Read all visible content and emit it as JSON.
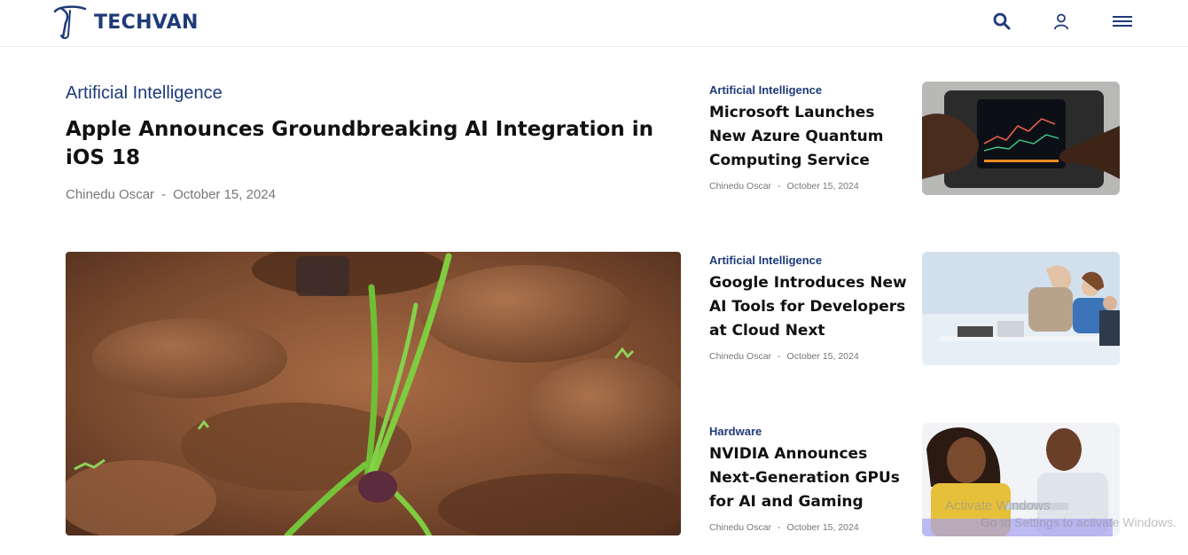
{
  "header": {
    "brand": "TECHVAN",
    "icons": [
      "search-icon",
      "user-icon",
      "menu-icon"
    ],
    "brand_color": "#1e3a78"
  },
  "featured": {
    "category": "Artificial Intelligence",
    "title": "Apple Announces Groundbreaking AI Integration in iOS 18",
    "author": "Chinedu Oscar",
    "separator": "-",
    "date": "October 15, 2024"
  },
  "side_articles": [
    {
      "category": "Artificial Intelligence",
      "title": "Microsoft Launches New Azure Quantum Computing Service",
      "author": "Chinedu Oscar",
      "separator": "-",
      "date": "October 15, 2024"
    },
    {
      "category": "Artificial Intelligence",
      "title": "Google Introduces New AI Tools for Developers at Cloud Next",
      "author": "Chinedu Oscar",
      "separator": "-",
      "date": "October 15, 2024"
    },
    {
      "category": "Hardware",
      "title": "NVIDIA Announces Next-Generation GPUs for AI and Gaming",
      "author": "Chinedu Oscar",
      "separator": "-",
      "date": "October 15, 2024"
    }
  ],
  "watermark": {
    "line1": "Activate Windows",
    "line2": "Go to Settings to activate Windows."
  }
}
